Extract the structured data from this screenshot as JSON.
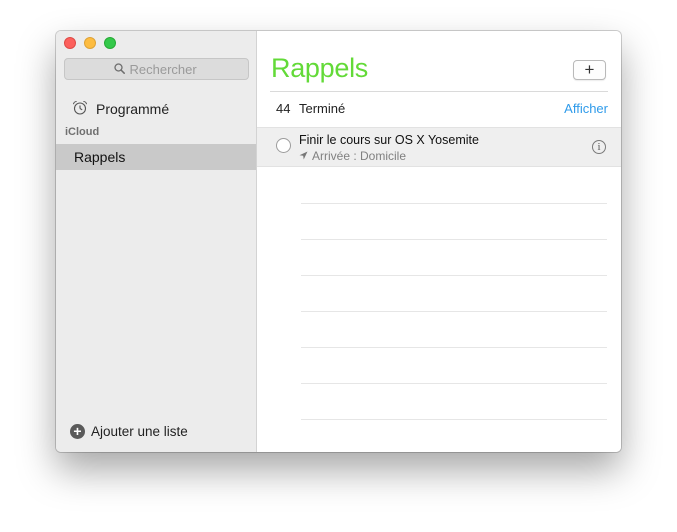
{
  "sidebar": {
    "search_placeholder": "Rechercher",
    "scheduled_label": "Programmé",
    "section_label": "iCloud",
    "selected_list": "Rappels",
    "add_list_label": "Ajouter une liste"
  },
  "main": {
    "title": "Rappels",
    "add_button_label": "+",
    "completed_count": "44",
    "completed_label": "Terminé",
    "show_label": "Afficher",
    "reminders": [
      {
        "title": "Finir le cours sur OS X Yosemite",
        "subtitle": "Arrivée : Domicile"
      }
    ]
  },
  "colors": {
    "accent_green": "#63da38",
    "link_blue": "#2f9bea",
    "close": "#fc605c",
    "minimize": "#fdbc40",
    "maximize": "#34c84a"
  },
  "icons": {
    "search": "magnifier",
    "scheduled": "alarm-clock",
    "location": "location-arrow",
    "info": "info-circle",
    "add_list": "plus-circle"
  }
}
